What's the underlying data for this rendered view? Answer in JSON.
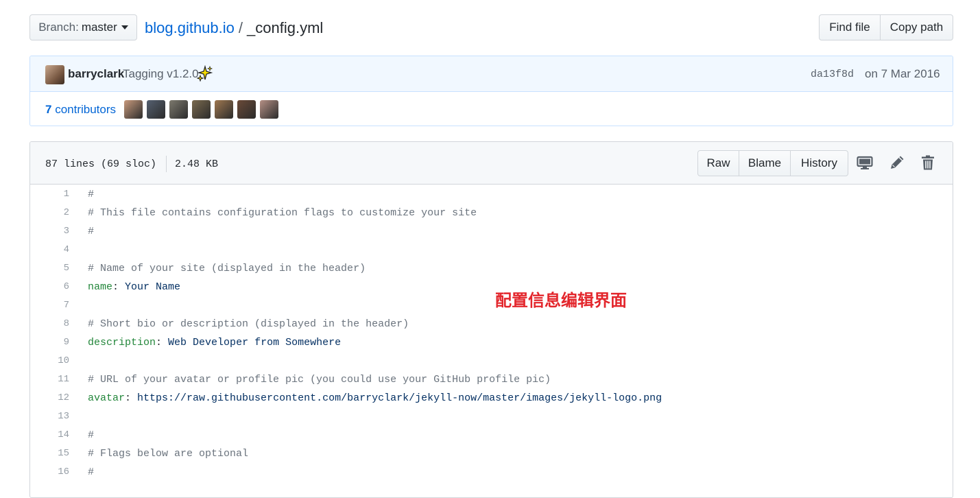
{
  "branch": {
    "label": "Branch:",
    "value": "master"
  },
  "breadcrumb": {
    "repo": "blog.github.io",
    "separator": "/",
    "file": "_config.yml"
  },
  "top_actions": {
    "find_file": "Find file",
    "copy_path": "Copy path"
  },
  "commit": {
    "author": "barryclark",
    "message": "Tagging v1.2.0",
    "sha": "da13f8d",
    "date": "on 7 Mar 2016"
  },
  "contributors": {
    "count": "7",
    "label": "contributors",
    "avatar_colors": [
      "#c99b7d",
      "#556070",
      "#7d7a6e",
      "#7b6a4e",
      "#a07850",
      "#6a4a38",
      "#b59085"
    ]
  },
  "file": {
    "lines_info": "87 lines (69 sloc)",
    "size": "2.48 KB",
    "buttons": {
      "raw": "Raw",
      "blame": "Blame",
      "history": "History"
    },
    "lines": [
      {
        "n": "1",
        "comment": "#"
      },
      {
        "n": "2",
        "comment": "# This file contains configuration flags to customize your site"
      },
      {
        "n": "3",
        "comment": "#"
      },
      {
        "n": "4"
      },
      {
        "n": "5",
        "comment": "# Name of your site (displayed in the header)"
      },
      {
        "n": "6",
        "key": "name",
        "value": "Your Name"
      },
      {
        "n": "7"
      },
      {
        "n": "8",
        "comment": "# Short bio or description (displayed in the header)"
      },
      {
        "n": "9",
        "key": "description",
        "value": "Web Developer from Somewhere"
      },
      {
        "n": "10"
      },
      {
        "n": "11",
        "comment": "# URL of your avatar or profile pic (you could use your GitHub profile pic)"
      },
      {
        "n": "12",
        "key": "avatar",
        "value": "https://raw.githubusercontent.com/barryclark/jekyll-now/master/images/jekyll-logo.png"
      },
      {
        "n": "13"
      },
      {
        "n": "14",
        "comment": "#"
      },
      {
        "n": "15",
        "comment": "# Flags below are optional"
      },
      {
        "n": "16",
        "comment": "#"
      }
    ]
  },
  "annotation": "配置信息编辑界面",
  "colors": {
    "link": "#0366d6",
    "annotation": "#e3262c",
    "yaml_key": "#22863a",
    "comment": "#6a737d"
  }
}
